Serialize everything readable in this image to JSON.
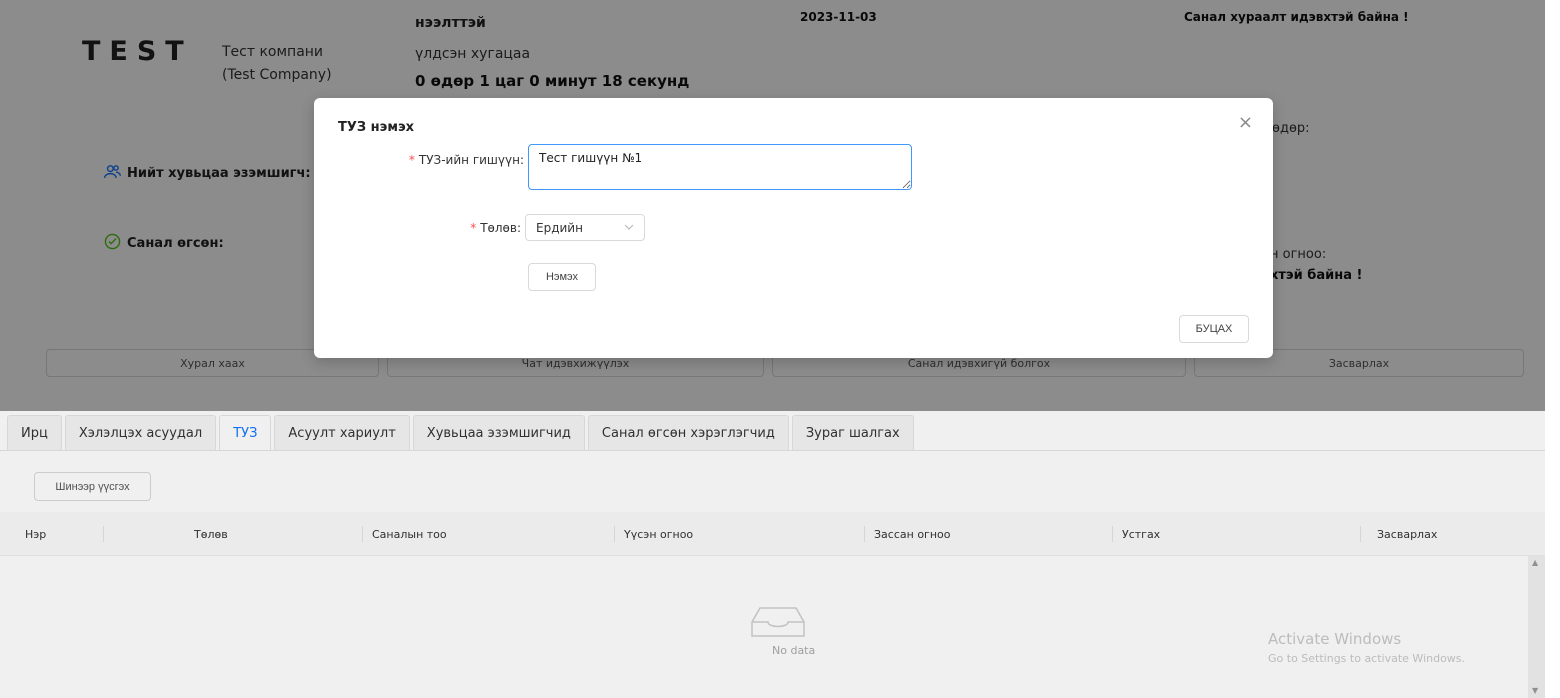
{
  "header": {
    "logo": "TEST",
    "company_name_line1": "Тест компани",
    "company_name_line2": "(Test Company)",
    "status_top": "нээлттэй",
    "remaining_label": "үлдсэн хугацаа",
    "remaining_value": "0 өдөр 1 цаг 0 минут 18 секунд",
    "date": "2023-11-03",
    "vote_status": "Санал хураалт идэвхтэй байна !"
  },
  "stats": {
    "holders_label": "Нийт хувьцаа эзэмшигч:",
    "voted_label": "Санал өгсөн:",
    "right_day_label": "өдөр:",
    "right_date_label": "н огноо:",
    "right_status": "хтэй байна !"
  },
  "actions": {
    "close_meeting": "Хурал хаах",
    "enable_chat": "Чат идэвхижүүлэх",
    "disable_vote": "Санал идэвхигүй болгох",
    "edit": "Засварлах"
  },
  "modal": {
    "title": "ТУЗ нэмэх",
    "close_glyph": "×",
    "member_label": "ТУЗ-ийн гишүүн",
    "member_value": "Тест гишүүн №1",
    "status_label": "Төлөв",
    "status_value": "Ердийн",
    "required_mark": "*",
    "colon": ":",
    "add_button": "Нэмэх",
    "back_button": "БУЦАХ"
  },
  "tabs": [
    {
      "label": "Ирц",
      "active": false
    },
    {
      "label": "Хэлэлцэх асуудал",
      "active": false
    },
    {
      "label": "ТУЗ",
      "active": true
    },
    {
      "label": "Асуулт хариулт",
      "active": false
    },
    {
      "label": "Хувьцаа эзэмшигчид",
      "active": false
    },
    {
      "label": "Санал өгсөн хэрэглэгчид",
      "active": false
    },
    {
      "label": "Зураг шалгах",
      "active": false
    }
  ],
  "new_button": "Шинээр үүсгэх",
  "table": {
    "columns": [
      "Нэр",
      "Төлөв",
      "Саналын тоо",
      "Үүсэн огноо",
      "Зассан огноо",
      "Устгах",
      "Засварлах"
    ],
    "empty_text": "No data"
  },
  "watermark": {
    "line1": "Activate Windows",
    "line2": "Go to Settings to activate Windows."
  },
  "colors": {
    "primary": "#1677ff",
    "required": "#ff4d4f",
    "success": "#52c41a",
    "overlay": "rgba(0,0,0,0.45)"
  },
  "icons": {
    "holders": "users-icon",
    "voted": "check-circle-icon",
    "modal_close": "close-icon",
    "select_chevron": "chevron-down-icon",
    "empty": "inbox-icon"
  }
}
